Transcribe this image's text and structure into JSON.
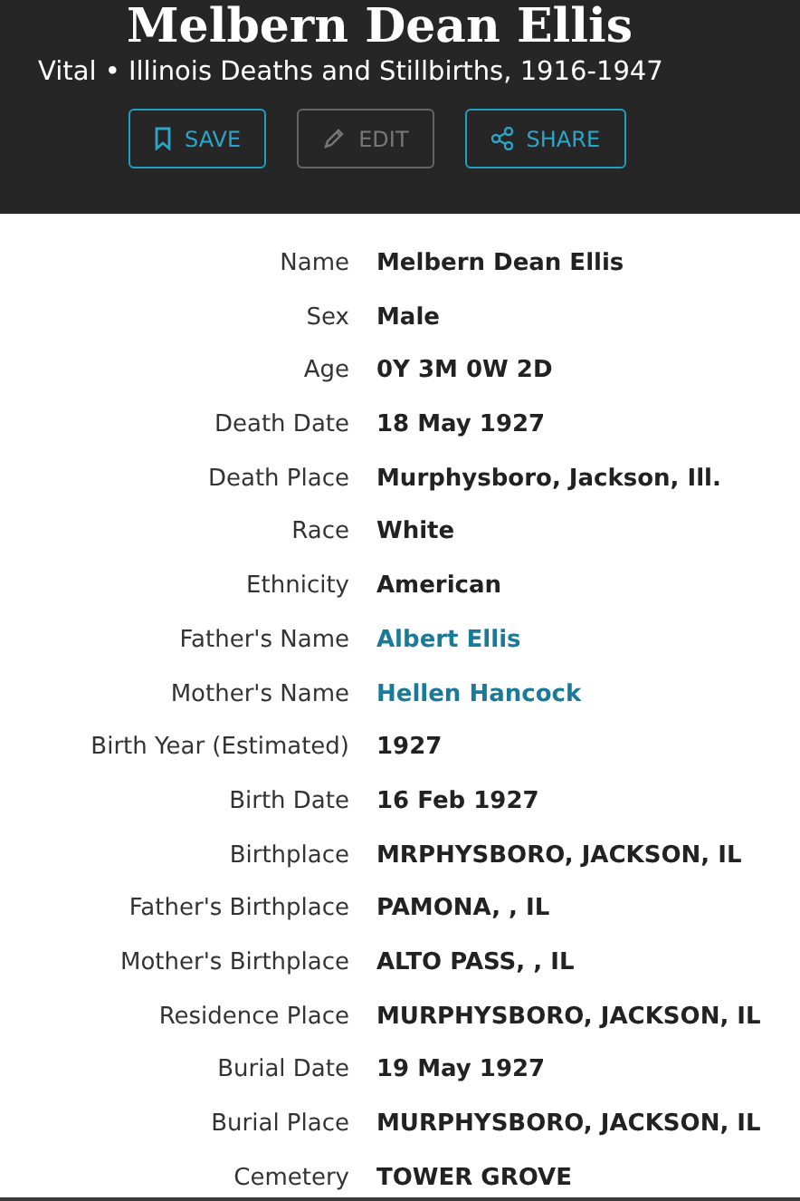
{
  "header": {
    "title": "Melbern Dean Ellis",
    "subtitle": "Vital • Illinois Deaths and Stillbirths, 1916-1947",
    "buttons": [
      {
        "kind": "save",
        "label": "SAVE",
        "disabled": false
      },
      {
        "kind": "edit",
        "label": "EDIT",
        "disabled": true
      },
      {
        "kind": "share",
        "label": "SHARE",
        "disabled": false
      }
    ]
  },
  "facts": [
    {
      "label": "Name",
      "value": "Melbern Dean Ellis",
      "kind": "text"
    },
    {
      "label": "Sex",
      "value": "Male",
      "kind": "text"
    },
    {
      "label": "Age",
      "value": "0Y 3M 0W 2D",
      "kind": "text"
    },
    {
      "label": "Death Date",
      "value": "18 May 1927",
      "kind": "text"
    },
    {
      "label": "Death Place",
      "value": "Murphysboro, Jackson, Ill.",
      "kind": "text"
    },
    {
      "label": "Race",
      "value": "White",
      "kind": "text"
    },
    {
      "label": "Ethnicity",
      "value": "American",
      "kind": "text"
    },
    {
      "label": "Father's Name",
      "value": "Albert Ellis",
      "kind": "link"
    },
    {
      "label": "Mother's Name",
      "value": "Hellen Hancock",
      "kind": "link"
    },
    {
      "label": "Birth Year (Estimated)",
      "value": "1927",
      "kind": "text"
    },
    {
      "label": "Birth Date",
      "value": "16 Feb 1927",
      "kind": "text"
    },
    {
      "label": "Birthplace",
      "value": "MRPHYSBORO, JACKSON, IL",
      "kind": "text"
    },
    {
      "label": "Father's Birthplace",
      "value": "PAMONA, , IL",
      "kind": "text"
    },
    {
      "label": "Mother's Birthplace",
      "value": "ALTO PASS, , IL",
      "kind": "text"
    },
    {
      "label": "Residence Place",
      "value": "MURPHYSBORO, JACKSON, IL",
      "kind": "text"
    },
    {
      "label": "Burial Date",
      "value": "19 May 1927",
      "kind": "text"
    },
    {
      "label": "Burial Place",
      "value": "MURPHYSBORO, JACKSON, IL",
      "kind": "text"
    },
    {
      "label": "Cemetery",
      "value": "TOWER GROVE",
      "kind": "text"
    }
  ]
}
